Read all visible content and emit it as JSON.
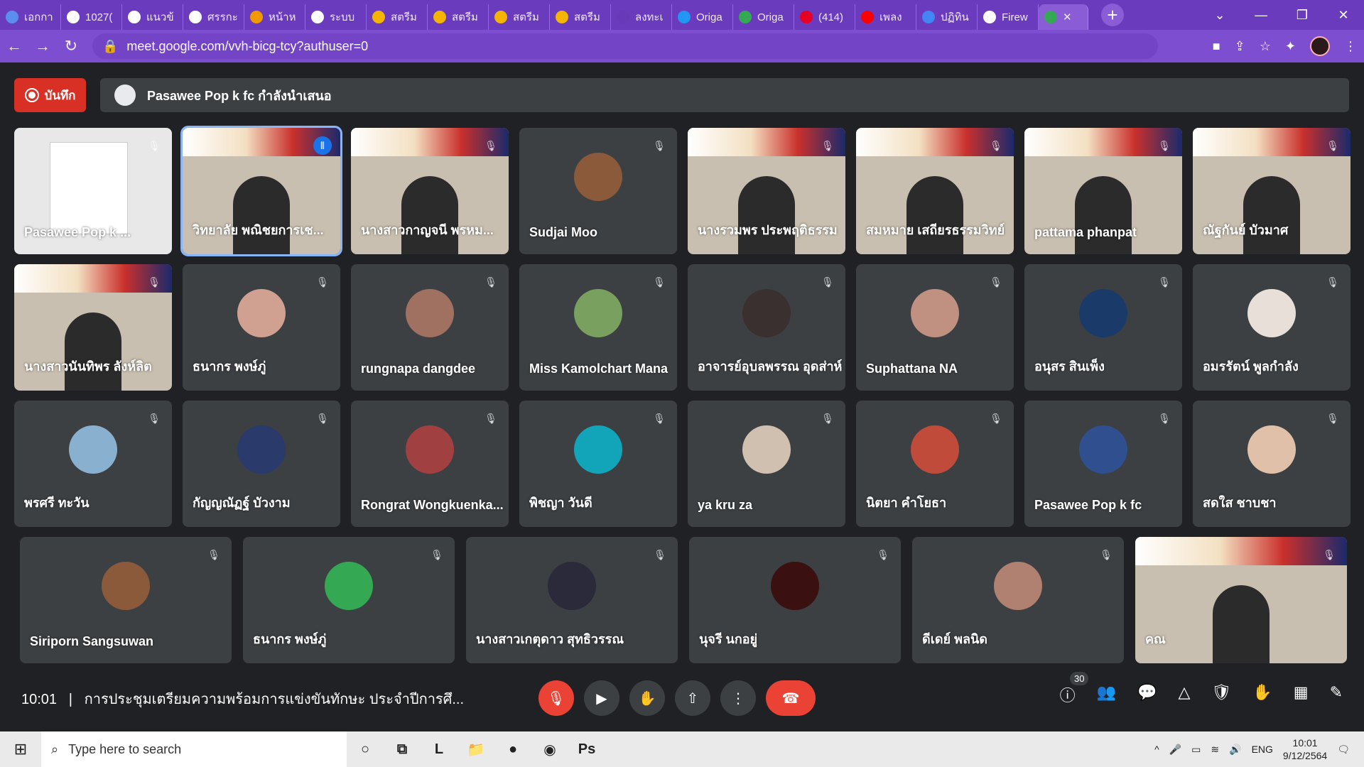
{
  "browser": {
    "tabs": [
      {
        "label": "เอกกา",
        "color": "#5b8def"
      },
      {
        "label": "1027(",
        "color": "#ffffff"
      },
      {
        "label": "แนวข้",
        "color": "#ffffff"
      },
      {
        "label": "ศรรกะ",
        "color": "#ffffff"
      },
      {
        "label": "หน้าห",
        "color": "#f29900"
      },
      {
        "label": "ระบบ",
        "color": "#ffffff"
      },
      {
        "label": "สตรีม",
        "color": "#f4b400"
      },
      {
        "label": "สตรีม",
        "color": "#f4b400"
      },
      {
        "label": "สตรีม",
        "color": "#f4b400"
      },
      {
        "label": "สตรีม",
        "color": "#f4b400"
      },
      {
        "label": "ลงทะเ",
        "color": "#673ab7"
      },
      {
        "label": "Origa",
        "color": "#2196f3"
      },
      {
        "label": "Origa",
        "color": "#34a853"
      },
      {
        "label": "(414)",
        "color": "#e60023"
      },
      {
        "label": "เพลง",
        "color": "#ff0000"
      },
      {
        "label": "ปฏิทิน",
        "color": "#4285f4"
      },
      {
        "label": "Firew",
        "color": "#ffffff"
      }
    ],
    "url": "meet.google.com/vvh-bicg-tcy?authuser=0"
  },
  "meet": {
    "record_label": "บันทึก",
    "presenting_text": "Pasawee Pop k fc กำลังนำเสนอ",
    "participants": [
      {
        "name": "Pasawee Pop k ...",
        "type": "screen"
      },
      {
        "name": "วิทยาลัย พณิชยการเช...",
        "type": "video",
        "speaking": true
      },
      {
        "name": "นางสาวกาญจนี พรหม...",
        "type": "video"
      },
      {
        "name": "Sudjai Moo",
        "type": "avatar"
      },
      {
        "name": "นางรวมพร ประพฤติธรรม",
        "type": "video"
      },
      {
        "name": "สมหมาย เสถียรธรรมวิทย์",
        "type": "video"
      },
      {
        "name": "pattama phanpat",
        "type": "video"
      },
      {
        "name": "ณัฐกันย์ บัวมาศ",
        "type": "video"
      },
      {
        "name": "นางสาวนันทิพร ลังห์ลิต",
        "type": "video"
      },
      {
        "name": "ธนากร พงษ์ภู่",
        "type": "avatar"
      },
      {
        "name": "rungnapa dangdee",
        "type": "avatar"
      },
      {
        "name": "Miss Kamolchart Mana",
        "type": "avatar"
      },
      {
        "name": "อาจารย์อุบลพรรณ อุดส่าห์",
        "type": "avatar"
      },
      {
        "name": "Suphattana NA",
        "type": "avatar"
      },
      {
        "name": "อนุสร สินเพ็ง",
        "type": "avatar"
      },
      {
        "name": "อมรรัตน์ พูลกำลัง",
        "type": "avatar"
      },
      {
        "name": "พรศรี ทะวัน",
        "type": "avatar"
      },
      {
        "name": "กัญญณัฏฐ์ บัวงาม",
        "type": "avatar"
      },
      {
        "name": "Rongrat Wongkuenka...",
        "type": "avatar"
      },
      {
        "name": "พิชญา วันดี",
        "type": "avatar"
      },
      {
        "name": "ya kru za",
        "type": "avatar"
      },
      {
        "name": "นิตยา คำโยธา",
        "type": "avatar"
      },
      {
        "name": "Pasawee Pop k fc",
        "type": "avatar"
      },
      {
        "name": "สดใส ชาบชา",
        "type": "avatar"
      },
      {
        "name": "Siriporn Sangsuwan",
        "type": "avatar"
      },
      {
        "name": "ธนากร พงษ์ภู่",
        "type": "avatar"
      },
      {
        "name": "นางสาวเกตุดาว สุทธิวรรณ",
        "type": "avatar"
      },
      {
        "name": "นุจรี นกอยู่",
        "type": "avatar"
      },
      {
        "name": "ดีเดย์ พลนิด",
        "type": "avatar"
      },
      {
        "name": "คณ",
        "type": "video"
      }
    ],
    "time": "10:01",
    "meeting_title": "การประชุมเตรียมความพร้อมการแข่งขันทักษะ ประจำปีการศึ...",
    "participant_count": "30"
  },
  "taskbar": {
    "search_placeholder": "Type here to search",
    "language": "ENG",
    "time": "10:01",
    "date": "9/12/2564"
  },
  "colors": {
    "tabstrip": "#6a3bbd",
    "addressbar": "#7e4ed0",
    "meet_bg": "#202124",
    "tile_bg": "#3c4043",
    "danger": "#ea4335",
    "record": "#d93025"
  }
}
